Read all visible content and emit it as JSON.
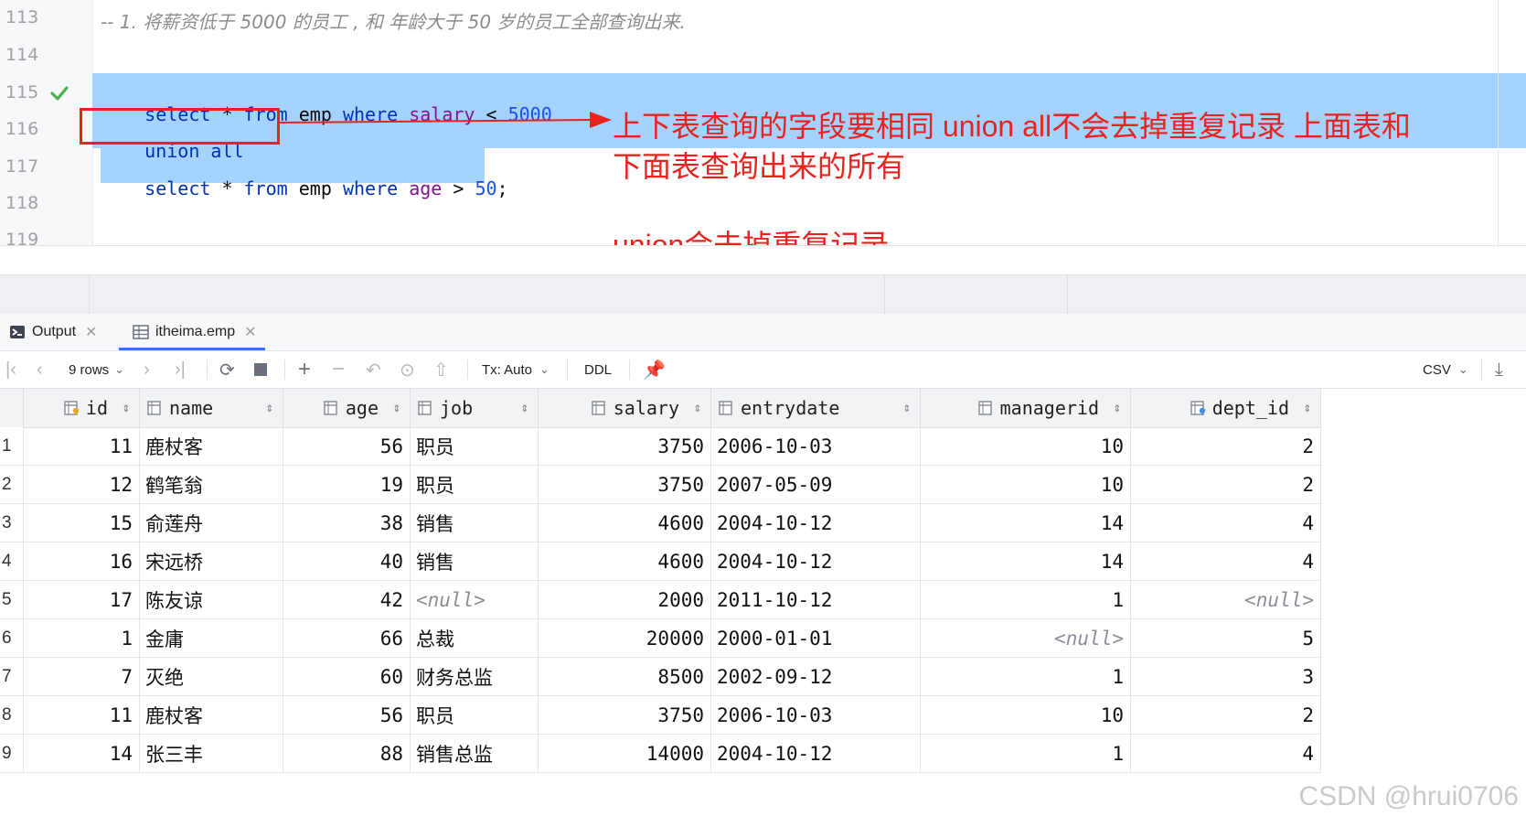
{
  "editor": {
    "lines": [
      {
        "no": "113",
        "comment": "-- 1. 将薪资低于 5000 的员工 , 和 年龄大于 50 岁的员工全部查询出来."
      },
      {
        "no": "114"
      },
      {
        "no": "115",
        "tokens": [
          "select",
          " * ",
          "from",
          " emp ",
          "where",
          " ",
          "salary",
          " < ",
          "5000"
        ]
      },
      {
        "no": "116",
        "tokens": [
          "union all"
        ]
      },
      {
        "no": "117",
        "tokens": [
          "select",
          " * ",
          "from",
          " emp ",
          "where",
          " ",
          "age",
          " > ",
          "50",
          ";"
        ]
      },
      {
        "no": "118"
      },
      {
        "no": "119"
      }
    ]
  },
  "annotation": {
    "line1": "上下表查询的字段要相同  union all不会去掉重复记录 上面表和",
    "line2": "下面表查询出来的所有",
    "line3": "union会去掉重复记录",
    "color": "#e8231f"
  },
  "tabs": [
    {
      "label": "Output",
      "icon": "output-console-icon",
      "active": false
    },
    {
      "label": "itheima.emp",
      "icon": "table-icon",
      "active": true
    }
  ],
  "toolbar": {
    "rows_label": "9 rows",
    "tx_label": "Tx: Auto",
    "ddl_label": "DDL",
    "export_label": "CSV"
  },
  "grid": {
    "columns": [
      {
        "name": "id",
        "icon": "primary-key-column-icon"
      },
      {
        "name": "name",
        "icon": "column-icon"
      },
      {
        "name": "age",
        "icon": "column-icon"
      },
      {
        "name": "job",
        "icon": "column-icon"
      },
      {
        "name": "salary",
        "icon": "column-icon"
      },
      {
        "name": "entrydate",
        "icon": "column-icon"
      },
      {
        "name": "managerid",
        "icon": "column-icon"
      },
      {
        "name": "dept_id",
        "icon": "foreign-key-column-icon"
      }
    ],
    "null_text": "<null>",
    "rows": [
      {
        "n": "1",
        "id": "11",
        "name": "鹿杖客",
        "age": "56",
        "job": "职员",
        "salary": "3750",
        "entrydate": "2006-10-03",
        "managerid": "10",
        "dept_id": "2"
      },
      {
        "n": "2",
        "id": "12",
        "name": "鹤笔翁",
        "age": "19",
        "job": "职员",
        "salary": "3750",
        "entrydate": "2007-05-09",
        "managerid": "10",
        "dept_id": "2"
      },
      {
        "n": "3",
        "id": "15",
        "name": "俞莲舟",
        "age": "38",
        "job": "销售",
        "salary": "4600",
        "entrydate": "2004-10-12",
        "managerid": "14",
        "dept_id": "4"
      },
      {
        "n": "4",
        "id": "16",
        "name": "宋远桥",
        "age": "40",
        "job": "销售",
        "salary": "4600",
        "entrydate": "2004-10-12",
        "managerid": "14",
        "dept_id": "4"
      },
      {
        "n": "5",
        "id": "17",
        "name": "陈友谅",
        "age": "42",
        "job": null,
        "salary": "2000",
        "entrydate": "2011-10-12",
        "managerid": "1",
        "dept_id": null
      },
      {
        "n": "6",
        "id": "1",
        "name": "金庸",
        "age": "66",
        "job": "总裁",
        "salary": "20000",
        "entrydate": "2000-01-01",
        "managerid": null,
        "dept_id": "5"
      },
      {
        "n": "7",
        "id": "7",
        "name": "灭绝",
        "age": "60",
        "job": "财务总监",
        "salary": "8500",
        "entrydate": "2002-09-12",
        "managerid": "1",
        "dept_id": "3"
      },
      {
        "n": "8",
        "id": "11",
        "name": "鹿杖客",
        "age": "56",
        "job": "职员",
        "salary": "3750",
        "entrydate": "2006-10-03",
        "managerid": "10",
        "dept_id": "2"
      },
      {
        "n": "9",
        "id": "14",
        "name": "张三丰",
        "age": "88",
        "job": "销售总监",
        "salary": "14000",
        "entrydate": "2004-10-12",
        "managerid": "1",
        "dept_id": "4"
      }
    ]
  },
  "watermark": "CSDN @hrui0706"
}
